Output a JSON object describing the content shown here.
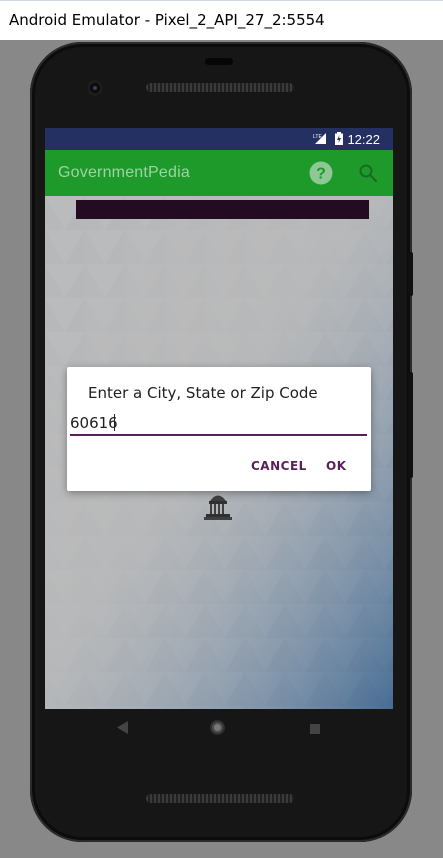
{
  "window": {
    "title": "Android Emulator - Pixel_2_API_27_2:5554"
  },
  "status_bar": {
    "time": "12:22",
    "signal_icon": "signal-lte-icon",
    "battery_icon": "battery-charging-icon"
  },
  "app_bar": {
    "title": "GovernmentPedia",
    "help_icon": "help-icon",
    "search_icon": "search-icon"
  },
  "dialog": {
    "title": "Enter a City, State or Zip Code",
    "input_value": "60616",
    "cancel_label": "CANCEL",
    "ok_label": "OK"
  },
  "colors": {
    "status_bar": "#242f62",
    "app_bar": "#1e9a2a",
    "accent": "#5a1f5a",
    "banner": "#250c24"
  },
  "nav_bar": {
    "back_icon": "back-icon",
    "home_icon": "home-icon",
    "recents_icon": "recents-icon"
  }
}
